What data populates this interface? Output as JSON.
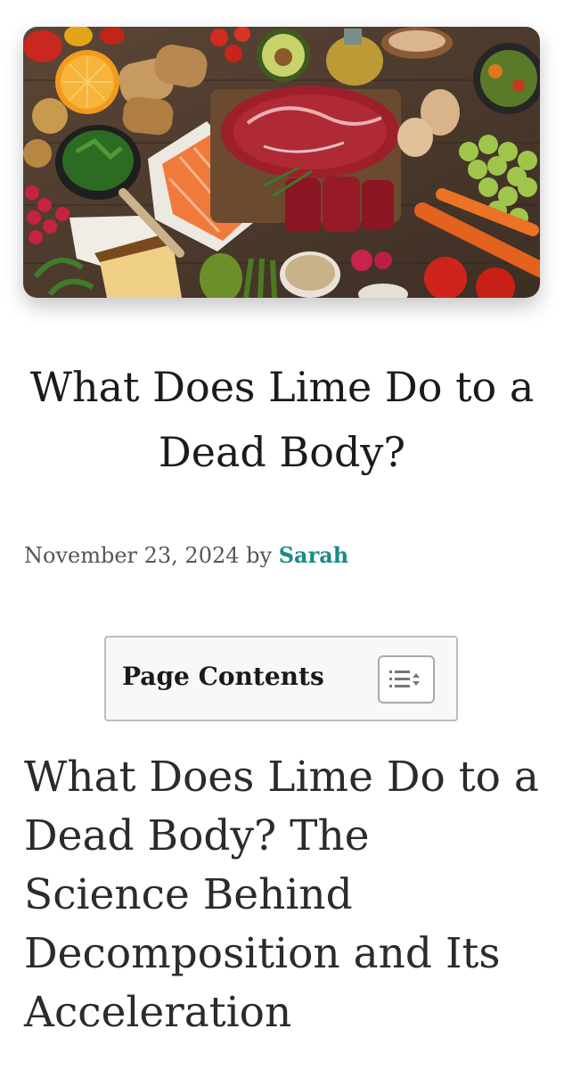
{
  "article": {
    "title": "What Does Lime Do to a Dead Body?",
    "date": "November 23, 2024",
    "by": "by",
    "author": "Sarah"
  },
  "toc": {
    "title": "Page Contents",
    "toggle_icon": "list-toggle-icon"
  },
  "section": {
    "heading": "What Does Lime Do to a Dead Body? The Science Behind Decomposition and Its Acceleration"
  },
  "colors": {
    "author_link": "#1a8a86",
    "text": "#1b1b1b",
    "meta_text": "#555555",
    "toc_border": "#bdbdbd"
  }
}
